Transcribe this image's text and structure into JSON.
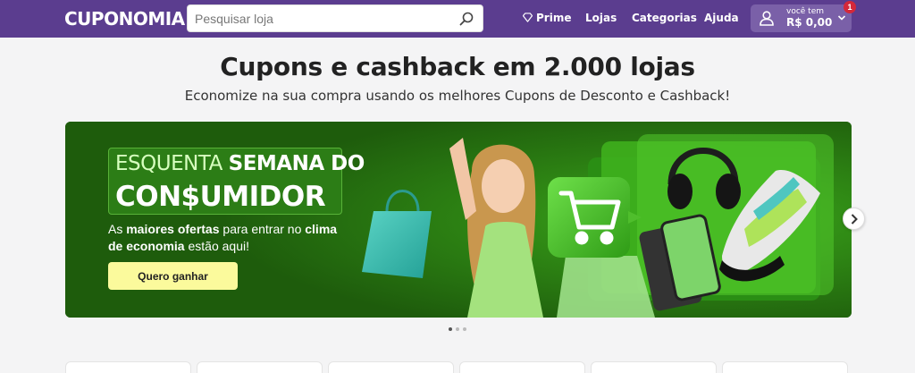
{
  "header": {
    "logo": "CUPONOMIA",
    "search_placeholder": "Pesquisar loja",
    "nav": {
      "prime": "Prime",
      "lojas": "Lojas",
      "categorias": "Categorias",
      "ajuda": "Ajuda"
    },
    "account": {
      "label": "você tem",
      "balance": "R$ 0,00",
      "notification_count": "1"
    }
  },
  "hero": {
    "title": "Cupons e cashback em 2.000 lojas",
    "subtitle": "Economize na sua compra usando os melhores Cupons de Desconto e Cashback!"
  },
  "banner": {
    "headline_part1": "ESQUENTA",
    "headline_part2": "SEMANA DO",
    "headline_line2": "CON$UMIDOR",
    "desc_1": "As ",
    "desc_2": "maiores ofertas",
    "desc_3": " para entrar no ",
    "desc_4": "clima de economia",
    "desc_5": " estão aqui!",
    "cta": "Quero ganhar"
  },
  "carousel": {
    "slide_count": 3,
    "active_index": 0
  },
  "colors": {
    "brand_purple": "#5b3d8f",
    "banner_green": "#1e5c0c",
    "cta_yellow": "#fbfa9c",
    "badge_red": "#d4283a"
  },
  "icons": [
    "search-icon",
    "diamond-icon",
    "user-icon",
    "chevron-down-icon",
    "chevron-right-icon",
    "cart-icon"
  ]
}
